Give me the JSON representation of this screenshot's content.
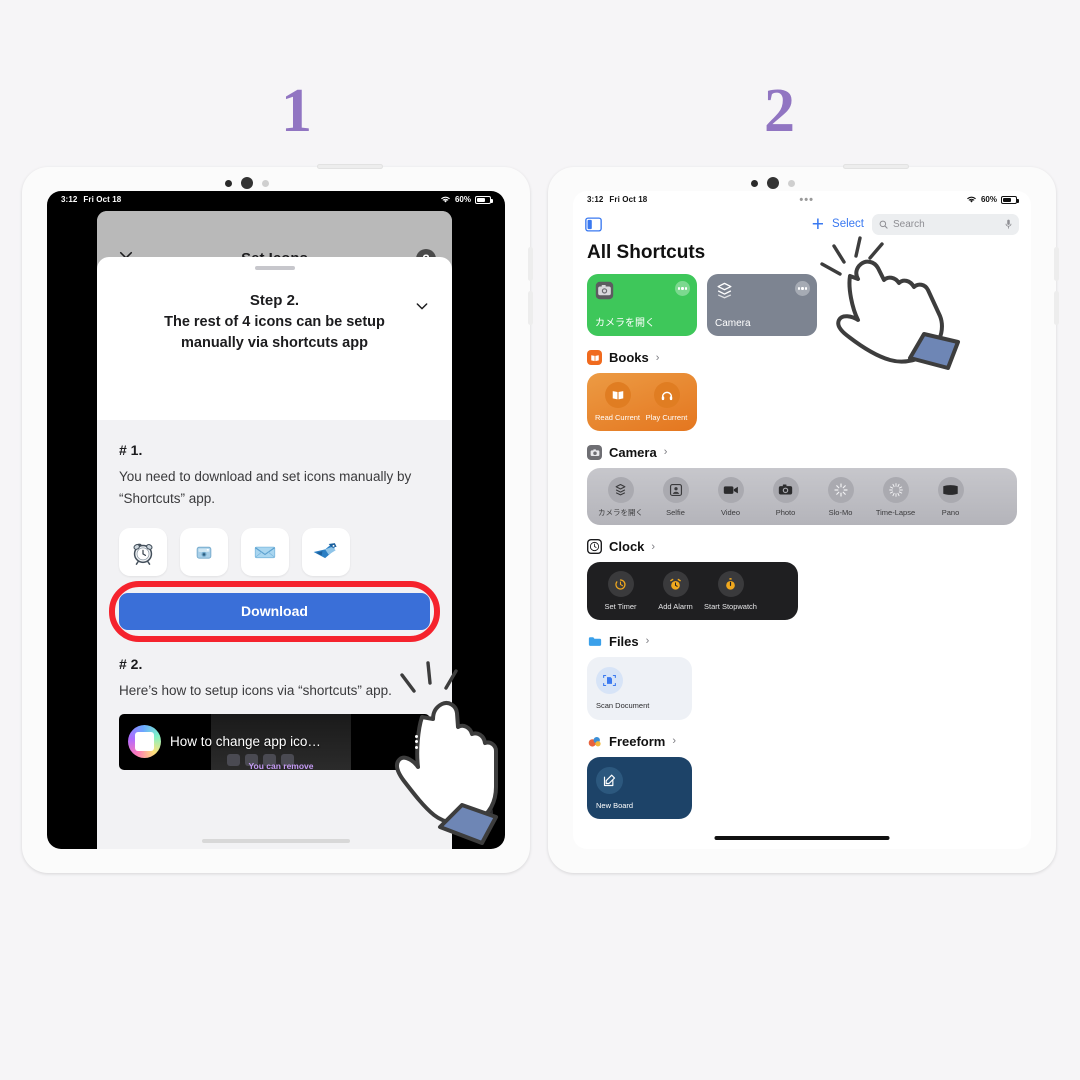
{
  "steps": [
    {
      "num": "1"
    },
    {
      "num": "2"
    }
  ],
  "accent": {
    "purple": "#9175c2",
    "red": "#f5232d",
    "blue": "#3a6fd8",
    "ios_blue": "#3a79f0"
  },
  "left_tablet": {
    "status": {
      "time": "3:12",
      "date": "Fri Oct 18",
      "battery": "60%",
      "wifi_icon": "wifi-icon"
    },
    "navbar": {
      "title": "Set Icons",
      "close_icon": "close-icon",
      "help_label": "?"
    },
    "sheet": {
      "step_title": "Step 2.",
      "step_desc": "The rest of 4 icons can be setup manually via shortcuts app",
      "chevron_icon": "chevron-down-icon"
    },
    "body": {
      "section1_tag": "# 1.",
      "section1_text": "You need to download and set icons manually by “Shortcuts” app.",
      "icons": [
        {
          "name": "alarm-clock-icon"
        },
        {
          "name": "instant-camera-icon"
        },
        {
          "name": "mail-envelope-icon"
        },
        {
          "name": "blue-bird-icon"
        }
      ],
      "download_label": "Download",
      "section2_tag": "# 2.",
      "section2_text": "Here’s how to setup icons via “shortcuts” app.",
      "video": {
        "title": "How to change app ico…",
        "caption": "You can remove",
        "menu_icon": "kebab-menu-icon"
      }
    },
    "float_button_icon": "collapse-arrows-icon"
  },
  "right_tablet": {
    "status": {
      "time": "3:12",
      "date": "Fri Oct 18",
      "battery": "60%",
      "wifi_icon": "wifi-icon",
      "dots": "•••"
    },
    "toolbar": {
      "sidebar_icon": "sidebar-toggle-icon",
      "plus_label": "+",
      "select_label": "Select",
      "search_placeholder": "Search",
      "search_icon": "search-icon",
      "mic_icon": "microphone-icon"
    },
    "page_title": "All Shortcuts",
    "top_cards": [
      {
        "name": "カメラを開く",
        "color": "#3ec75a",
        "icon": "camera-app-icon"
      },
      {
        "name": "Camera",
        "color": "#7d8491",
        "icon": "shortcuts-layers-icon"
      }
    ],
    "sections": [
      {
        "label": "Books",
        "icon": "books-app-icon",
        "icon_color": "#f06a1e",
        "panel_color": "#e8913a",
        "layout": "panel",
        "items": [
          {
            "label": "Read Current",
            "icon": "open-book-icon",
            "circle_color": "#e07d22"
          },
          {
            "label": "Play Current",
            "icon": "headphones-icon",
            "circle_color": "#e07d22"
          }
        ]
      },
      {
        "label": "Camera",
        "icon": "camera-app-icon",
        "icon_color": "#6e6e73",
        "panel_color": "#bdbdc2",
        "layout": "panel",
        "items": [
          {
            "label": "カメラを開く",
            "icon": "shortcuts-layers-icon",
            "circle_color": "#a9a9af"
          },
          {
            "label": "Selfie",
            "icon": "selfie-portrait-icon",
            "circle_color": "#a9a9af"
          },
          {
            "label": "Video",
            "icon": "video-camera-icon",
            "circle_color": "#a9a9af"
          },
          {
            "label": "Photo",
            "icon": "photo-camera-icon",
            "circle_color": "#a9a9af"
          },
          {
            "label": "Slo-Mo",
            "icon": "slomo-icon",
            "circle_color": "#a9a9af"
          },
          {
            "label": "Time-Lapse",
            "icon": "timelapse-icon",
            "circle_color": "#a9a9af"
          },
          {
            "label": "Pano",
            "icon": "panorama-icon",
            "circle_color": "#a9a9af"
          }
        ]
      },
      {
        "label": "Clock",
        "icon": "clock-app-icon",
        "icon_color": "#ffffff",
        "panel_color": "#1f1f21",
        "layout": "panel",
        "items": [
          {
            "label": "Set Timer",
            "icon": "timer-icon",
            "circle_color": "#3a3a3c"
          },
          {
            "label": "Add Alarm",
            "icon": "alarm-icon",
            "circle_color": "#3a3a3c"
          },
          {
            "label": "Start Stopwatch",
            "icon": "stopwatch-icon",
            "circle_color": "#3a3a3c"
          }
        ]
      },
      {
        "label": "Files",
        "icon": "files-folder-icon",
        "icon_color": "#3aa0ea",
        "panel_color": "#eef1f6",
        "layout": "tile",
        "items": [
          {
            "label": "Scan Document",
            "icon": "scan-document-icon",
            "circle_color": "#d7e4f7"
          }
        ]
      },
      {
        "label": "Freeform",
        "icon": "freeform-app-icon",
        "icon_color": "#e8623c",
        "panel_color": "#1d4368",
        "layout": "tile",
        "items": [
          {
            "label": "New Board",
            "icon": "compose-board-icon",
            "circle_color": "#2c587e"
          }
        ]
      }
    ]
  },
  "cursors": [
    {
      "name": "tap-hand-cursor-download"
    },
    {
      "name": "tap-hand-cursor-plus"
    }
  ]
}
